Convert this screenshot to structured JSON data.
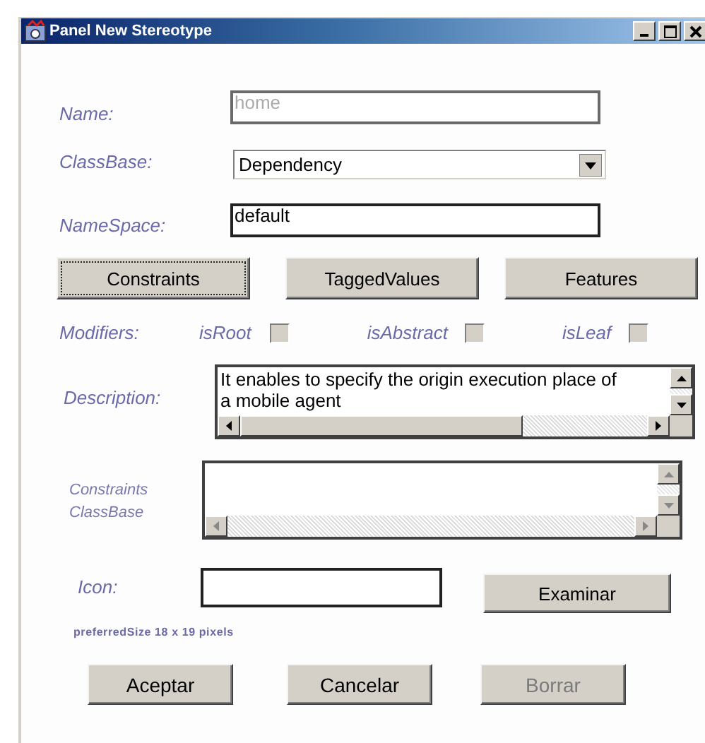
{
  "window": {
    "title": "Panel New Stereotype"
  },
  "name": {
    "label": "Name:",
    "placeholder": "home"
  },
  "class_base": {
    "label": "ClassBase:",
    "value": "Dependency"
  },
  "namespace": {
    "label": "NameSpace:",
    "value": "default"
  },
  "section_buttons": [
    {
      "label": "Constraints",
      "focused": true
    },
    {
      "label": "TaggedValues",
      "focused": false
    },
    {
      "label": "Features",
      "focused": false
    }
  ],
  "modifiers": {
    "label": "Modifiers:",
    "items": [
      {
        "label": "isRoot",
        "checked": false
      },
      {
        "label": "isAbstract",
        "checked": false
      },
      {
        "label": "isLeaf",
        "checked": false
      }
    ]
  },
  "description": {
    "label": "Description:",
    "value": "It enables to specify the origin execution place of a mobile agent"
  },
  "constraints_classbase": {
    "label": "Constraints ClassBase"
  },
  "icon": {
    "label": "Icon:",
    "button": "Examinar",
    "hint": "preferredSize 18 x 19 pixels"
  },
  "actions": [
    {
      "label": "Aceptar",
      "disabled": false
    },
    {
      "label": "Cancelar",
      "disabled": false
    },
    {
      "label": "Borrar",
      "disabled": true
    }
  ]
}
